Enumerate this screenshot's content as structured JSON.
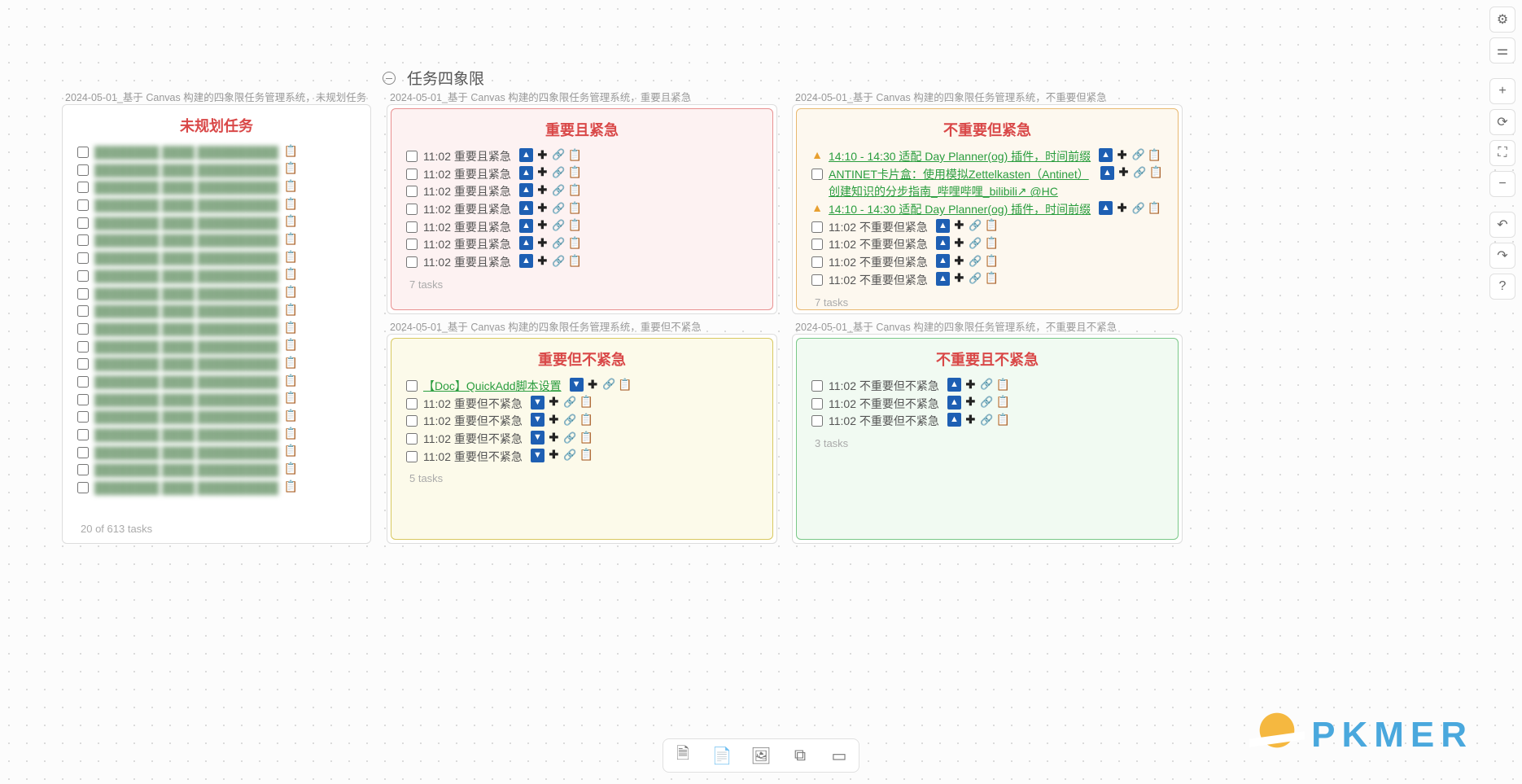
{
  "heading": "任务四象限",
  "cards": {
    "unplanned": {
      "label": "2024-05-01_基于 Canvas 构建的四象限任务管理系统，未规划任务",
      "title": "未规划任务",
      "title_color": "#d94848",
      "counter": "20 of 613 tasks"
    },
    "q1": {
      "label": "2024-05-01_基于 Canvas 构建的四象限任务管理系统，重要且紧急",
      "title": "重要且紧急",
      "title_color": "#d94848",
      "border_color": "#e89090",
      "bg_color": "#fdf2f2",
      "tasks": [
        {
          "time": "11:02",
          "text": "重要且紧急"
        },
        {
          "time": "11:02",
          "text": "重要且紧急"
        },
        {
          "time": "11:02",
          "text": "重要且紧急"
        },
        {
          "time": "11:02",
          "text": "重要且紧急"
        },
        {
          "time": "11:02",
          "text": "重要且紧急"
        },
        {
          "time": "11:02",
          "text": "重要且紧急"
        },
        {
          "time": "11:02",
          "text": "重要且紧急"
        }
      ],
      "counter": "7 tasks"
    },
    "q2": {
      "label": "2024-05-01_基于 Canvas 构建的四象限任务管理系统，不重要但紧急",
      "title": "不重要但紧急",
      "title_color": "#d94848",
      "border_color": "#e8b870",
      "bg_color": "#fdf8ef",
      "tasks": [
        {
          "warn": true,
          "text": "14:10 - 14:30 适配 Day Planner(og) 插件，时间前缀",
          "link": true
        },
        {
          "text": "ANTINET卡片盒：使用模拟Zettelkasten（Antinet）创建知识的分步指南_哔哩哔哩_bilibili↗ @HC",
          "link": true,
          "wrap": true
        },
        {
          "warn": true,
          "text": "14:10 - 14:30 适配 Day Planner(og) 插件，时间前缀",
          "link": true
        },
        {
          "time": "11:02",
          "text": "不重要但紧急"
        },
        {
          "time": "11:02",
          "text": "不重要但紧急"
        },
        {
          "time": "11:02",
          "text": "不重要但紧急"
        },
        {
          "time": "11:02",
          "text": "不重要但紧急"
        }
      ],
      "counter": "7 tasks"
    },
    "q3": {
      "label": "2024-05-01_基于 Canvas 构建的四象限任务管理系统，重要但不紧急",
      "title": "重要但不紧急",
      "title_color": "#d94848",
      "border_color": "#d8c860",
      "bg_color": "#fcfaea",
      "tasks": [
        {
          "text": "【Doc】QuickAdd脚本设置",
          "link": true,
          "down": true
        },
        {
          "time": "11:02",
          "text": "重要但不紧急",
          "down": true
        },
        {
          "time": "11:02",
          "text": "重要但不紧急",
          "down": true
        },
        {
          "time": "11:02",
          "text": "重要但不紧急",
          "down": true
        },
        {
          "time": "11:02",
          "text": "重要但不紧急",
          "down": true
        }
      ],
      "counter": "5 tasks"
    },
    "q4": {
      "label": "2024-05-01_基于 Canvas 构建的四象限任务管理系统，不重要且不紧急",
      "title": "不重要且不紧急",
      "title_color": "#d94848",
      "border_color": "#7ac888",
      "bg_color": "#f1faf2",
      "tasks": [
        {
          "time": "11:02",
          "text": "不重要但不紧急"
        },
        {
          "time": "11:02",
          "text": "不重要但不紧急"
        },
        {
          "time": "11:02",
          "text": "不重要但不紧急"
        }
      ],
      "counter": "3 tasks"
    }
  },
  "watermark": "PKMER"
}
